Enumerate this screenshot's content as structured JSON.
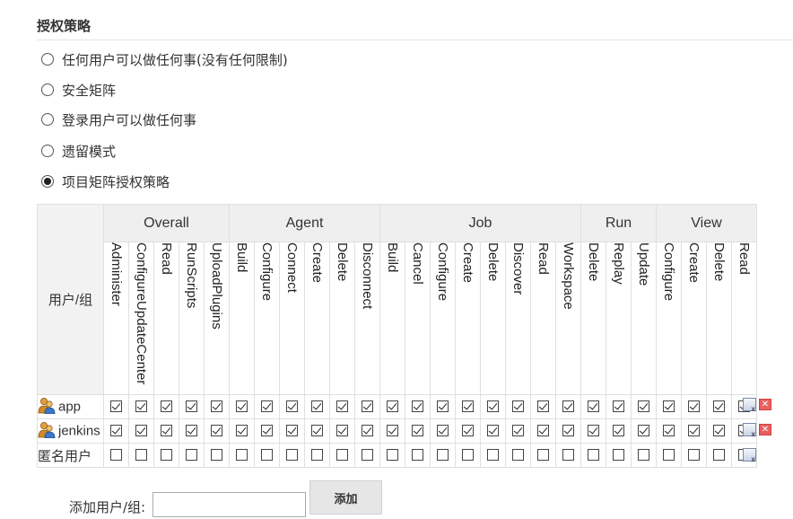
{
  "section": {
    "title": "授权策略"
  },
  "strategies": [
    {
      "label": "任何用户可以做任何事(没有任何限制)",
      "selected": false
    },
    {
      "label": "安全矩阵",
      "selected": false
    },
    {
      "label": "登录用户可以做任何事",
      "selected": false
    },
    {
      "label": "遗留模式",
      "selected": false
    },
    {
      "label": "项目矩阵授权策略",
      "selected": true
    }
  ],
  "matrix": {
    "user_header": "用户/组",
    "groups": [
      {
        "name": "Overall",
        "perms": [
          "Administer",
          "ConfigureUpdateCenter",
          "Read",
          "RunScripts",
          "UploadPlugins"
        ]
      },
      {
        "name": "Agent",
        "perms": [
          "Build",
          "Configure",
          "Connect",
          "Create",
          "Delete",
          "Disconnect"
        ]
      },
      {
        "name": "Job",
        "perms": [
          "Build",
          "Cancel",
          "Configure",
          "Create",
          "Delete",
          "Discover",
          "Read",
          "Workspace"
        ]
      },
      {
        "name": "Run",
        "perms": [
          "Delete",
          "Replay",
          "Update"
        ]
      },
      {
        "name": "View",
        "perms": [
          "Configure",
          "Create",
          "Delete",
          "Read"
        ]
      }
    ],
    "rows": [
      {
        "name": "app",
        "has_icon": true,
        "all_checked": true,
        "deletable": true
      },
      {
        "name": "jenkins",
        "has_icon": true,
        "all_checked": true,
        "deletable": true
      },
      {
        "name": "匿名用户",
        "has_icon": false,
        "all_checked": false,
        "deletable": false
      }
    ]
  },
  "add_user": {
    "label": "添加用户/组:",
    "value": "",
    "button_label": "添加"
  },
  "colors": {
    "checked": "#222222",
    "delete": "#e86060",
    "header_bg": "#efefef"
  },
  "icons": {
    "user": "user-icon",
    "select_all": "select-all-icon",
    "delete": "delete-icon"
  }
}
